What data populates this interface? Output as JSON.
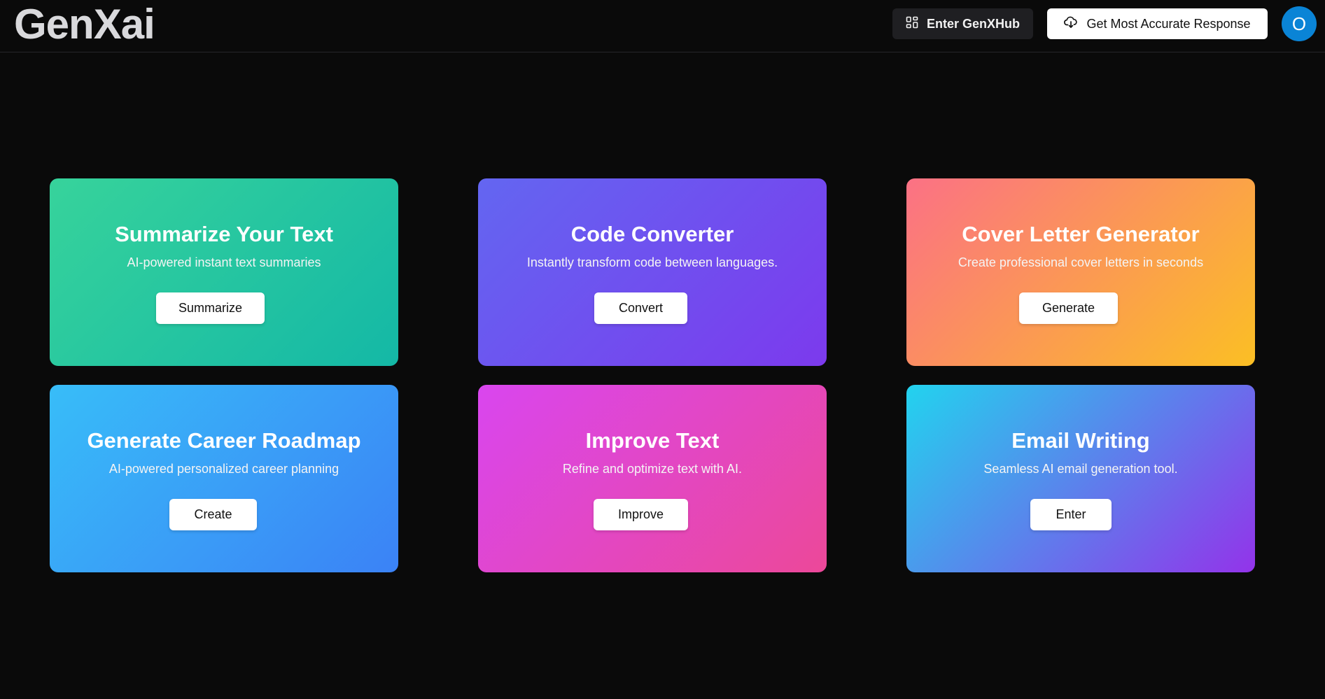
{
  "header": {
    "logo": "GenXai",
    "hub_button": {
      "label": "Enter GenXHub",
      "icon": "grid-icon"
    },
    "accurate_button": {
      "label": "Get Most Accurate Response",
      "icon": "cloud-download-icon"
    },
    "avatar_initial": "O"
  },
  "cards": [
    {
      "title": "Summarize Your Text",
      "subtitle": "AI-powered instant text summaries",
      "button": "Summarize",
      "gradient": [
        "#37d39b",
        "#14b8a6"
      ]
    },
    {
      "title": "Code Converter",
      "subtitle": "Instantly transform code between languages.",
      "button": "Convert",
      "gradient": [
        "#6366f1",
        "#7c3aed"
      ]
    },
    {
      "title": "Cover Letter Generator",
      "subtitle": "Create professional cover letters in seconds",
      "button": "Generate",
      "gradient": [
        "#fb7185",
        "#fbbf24"
      ]
    },
    {
      "title": "Generate Career Roadmap",
      "subtitle": "AI-powered personalized career planning",
      "button": "Create",
      "gradient": [
        "#38bdf8",
        "#3b82f6"
      ]
    },
    {
      "title": "Improve Text",
      "subtitle": "Refine and optimize text with AI.",
      "button": "Improve",
      "gradient": [
        "#d946ef",
        "#ec4899"
      ]
    },
    {
      "title": "Email Writing",
      "subtitle": "Seamless AI email generation tool.",
      "button": "Enter",
      "gradient": [
        "#22d3ee",
        "#9333ea"
      ]
    }
  ],
  "colors": {
    "background": "#0a0a0a",
    "avatar": "#0a84d6",
    "hub_button_bg": "#1f1f22"
  }
}
